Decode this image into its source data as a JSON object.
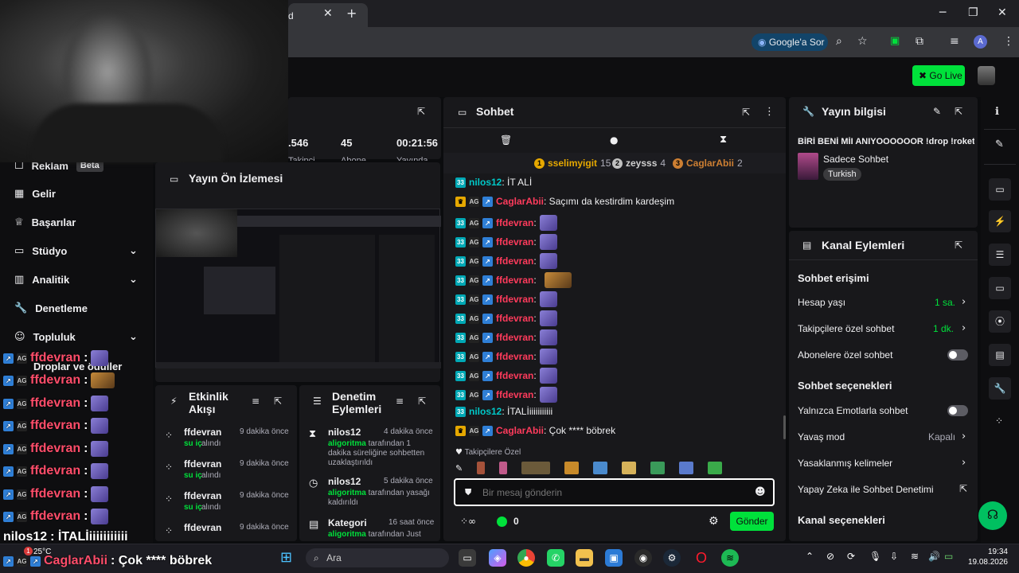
{
  "browser": {
    "tab_title": "d",
    "google_lens": "Google'a Sor",
    "profile_initial": "A"
  },
  "header": {
    "go_live": "Go Live"
  },
  "stats": {
    "val1": ".546",
    "val2": "45",
    "val3": "00:21:56",
    "lbl1": "Takipçi",
    "lbl2": "Abone",
    "lbl3": "Yayında"
  },
  "nav": {
    "reklam": "Reklam",
    "beta": "Beta",
    "gelir": "Gelir",
    "basarilar": "Başarılar",
    "studyo": "Stüdyo",
    "analitik": "Analitik",
    "denetleme": "Denetleme",
    "topluluk": "Topluluk",
    "droplar": "Droplar ve ödüller"
  },
  "preview": {
    "title": "Yayın Ön İzlemesi"
  },
  "activity": {
    "title": "Etkinlik Akışı",
    "items": [
      {
        "user": "ffdevran",
        "time": "9 dakika önce",
        "action": "su iç",
        "suffix": "alındı"
      },
      {
        "user": "ffdevran",
        "time": "9 dakika önce",
        "action": "su iç",
        "suffix": "alındı"
      },
      {
        "user": "ffdevran",
        "time": "9 dakika önce",
        "action": "su iç",
        "suffix": "alındı"
      },
      {
        "user": "ffdevran",
        "time": "9 dakika önce",
        "action": "",
        "suffix": ""
      }
    ]
  },
  "moderation": {
    "title": "Denetim Eylemleri",
    "items": [
      {
        "user": "nilos12",
        "time": "4 dakika önce",
        "actor": "aligoritma",
        "text": "tarafından 1 dakika süreliğine sohbetten uzaklaştırıldı"
      },
      {
        "user": "nilos12",
        "time": "5 dakika önce",
        "actor": "aligoritma",
        "text": "tarafından yasağı kaldırıldı"
      },
      {
        "user": "Kategori",
        "time": "16 saat önce",
        "actor": "aligoritma",
        "text": "tarafından Just"
      }
    ]
  },
  "chat": {
    "title": "Sohbet",
    "top": [
      {
        "rank": "1",
        "name": "sselimyigit",
        "count": "15"
      },
      {
        "rank": "2",
        "name": "zeysss",
        "count": "4"
      },
      {
        "rank": "3",
        "name": "CaglarAbii",
        "count": "2"
      }
    ],
    "messages": [
      {
        "user": "nilos12",
        "text": ": İT ALİ",
        "kind": "cyan"
      },
      {
        "user": "CaglarAbii",
        "text": ": Saçımı da kestirdim kardeşim",
        "kind": "red"
      },
      {
        "user": "ffdevran",
        "text": ":",
        "kind": "red"
      },
      {
        "user": "ffdevran",
        "text": ":",
        "kind": "red"
      },
      {
        "user": "ffdevran",
        "text": ":",
        "kind": "red"
      },
      {
        "user": "ffdevran",
        "text": ":",
        "kind": "red"
      },
      {
        "user": "ffdevran",
        "text": ":",
        "kind": "red"
      },
      {
        "user": "ffdevran",
        "text": ":",
        "kind": "red"
      },
      {
        "user": "ffdevran",
        "text": ":",
        "kind": "red"
      },
      {
        "user": "ffdevran",
        "text": ":",
        "kind": "red"
      },
      {
        "user": "ffdevran",
        "text": ":",
        "kind": "red"
      },
      {
        "user": "ffdevran",
        "text": ":",
        "kind": "red"
      },
      {
        "user": "ffdevran",
        "text": ":",
        "kind": "red"
      },
      {
        "user": "nilos12",
        "text": ": İTALİiiiiiiiiiii",
        "kind": "cyan"
      },
      {
        "user": "CaglarAbii",
        "text": ": Çok **** böbrek",
        "kind": "red"
      }
    ],
    "followers_only": "Takipçilere Özel",
    "placeholder": "Bir mesaj gönderin",
    "points": "0",
    "send": "Gönder"
  },
  "stream_info": {
    "title": "Yayın bilgisi",
    "stream_title": "BİRİ BENİ MİI ANIYOOOOOOR !drop !roket",
    "category": "Sadece Sohbet",
    "tag": "Turkish"
  },
  "channel_actions": {
    "title": "Kanal Eylemleri",
    "chat_access": "Sohbet erişimi",
    "account_age": "Hesap yaşı",
    "account_age_val": "1 sa.",
    "followers_chat": "Takipçilere özel sohbet",
    "followers_chat_val": "1 dk.",
    "subs_chat": "Abonelere özel sohbet",
    "chat_options": "Sohbet seçenekleri",
    "emote_only": "Yalnızca Emotlarla sohbet",
    "slow_mode": "Yavaş mod",
    "slow_mode_val": "Kapalı",
    "banned_words": "Yasaklanmış kelimeler",
    "ai_mod": "Yapay Zeka ile Sohbet Denetimi",
    "channel_options": "Kanal seçenekleri"
  },
  "overlay": {
    "lines": [
      "ffdevran",
      "ffdevran",
      "ffdevran",
      "ffdevran",
      "ffdevran",
      "ffdevran",
      "ffdevran",
      "ffdevran"
    ],
    "nilos": "nilos12",
    "nilos_text": ": İTALİiiiiiiiiiii",
    "caglar": "CaglarAbii",
    "caglar_text": ": Çok **** böbrek"
  },
  "taskbar": {
    "weather": "25°C",
    "weather_badge": "1",
    "search": "Ara",
    "time": "19:34",
    "date": "19.08.2026"
  },
  "colors": {
    "accent": "#00e13b",
    "username_red": "#ff3b5c",
    "username_cyan": "#00c8c8"
  }
}
